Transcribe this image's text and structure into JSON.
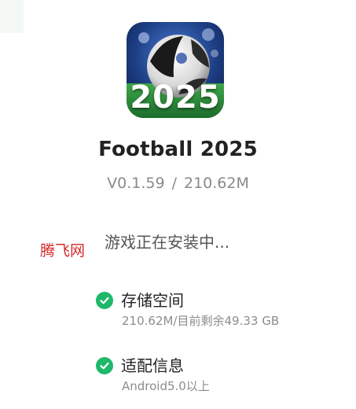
{
  "app": {
    "name": "Football 2025",
    "icon_text": "2025",
    "version": "V0.1.59",
    "separator": "/",
    "size": "210.62M"
  },
  "install": {
    "status": "游戏正在安装中..."
  },
  "watermark": {
    "text": "腾飞网"
  },
  "info": [
    {
      "title": "存储空间",
      "detail": "210.62M/目前剩余49.33 GB"
    },
    {
      "title": "适配信息",
      "detail": "Android5.0以上"
    }
  ],
  "colors": {
    "check": "#1fb86b",
    "watermark": "#d42a2a"
  }
}
